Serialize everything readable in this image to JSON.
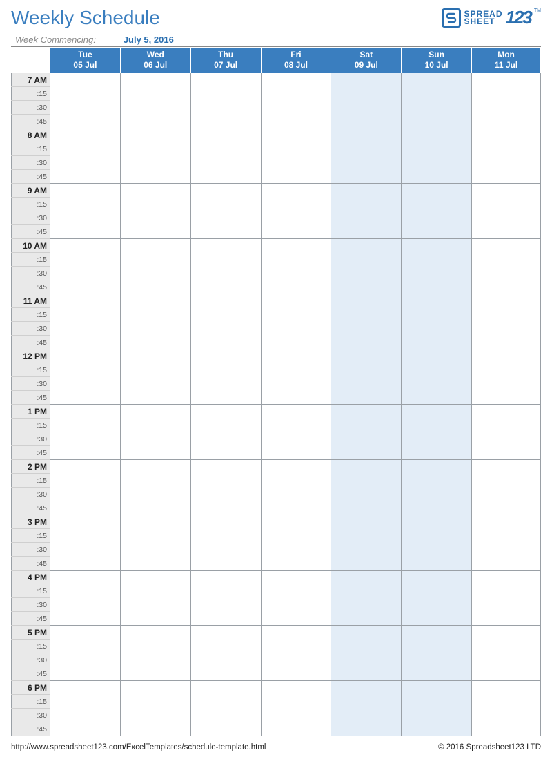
{
  "title": "Weekly Schedule",
  "week_commencing_label": "Week Commencing:",
  "week_commencing_date": "July 5, 2016",
  "logo": {
    "word1": "SPREAD",
    "word2": "SHEET",
    "digits": "123",
    "tm": "TM"
  },
  "days": [
    {
      "dow": "Tue",
      "date": "05 Jul",
      "weekend": false
    },
    {
      "dow": "Wed",
      "date": "06 Jul",
      "weekend": false
    },
    {
      "dow": "Thu",
      "date": "07 Jul",
      "weekend": false
    },
    {
      "dow": "Fri",
      "date": "08 Jul",
      "weekend": false
    },
    {
      "dow": "Sat",
      "date": "09 Jul",
      "weekend": true
    },
    {
      "dow": "Sun",
      "date": "10 Jul",
      "weekend": true
    },
    {
      "dow": "Mon",
      "date": "11 Jul",
      "weekend": false
    }
  ],
  "hours": [
    "7 AM",
    "8 AM",
    "9 AM",
    "10 AM",
    "11 AM",
    "12 PM",
    "1 PM",
    "2 PM",
    "3 PM",
    "4 PM",
    "5 PM",
    "6 PM"
  ],
  "quarters": [
    ":15",
    ":30",
    ":45"
  ],
  "footer": {
    "url": "http://www.spreadsheet123.com/ExcelTemplates/schedule-template.html",
    "copyright": "© 2016 Spreadsheet123 LTD"
  },
  "colors": {
    "accent": "#3a7ebf",
    "weekend_fill": "#e3edf7",
    "time_fill": "#e9e9e9"
  }
}
